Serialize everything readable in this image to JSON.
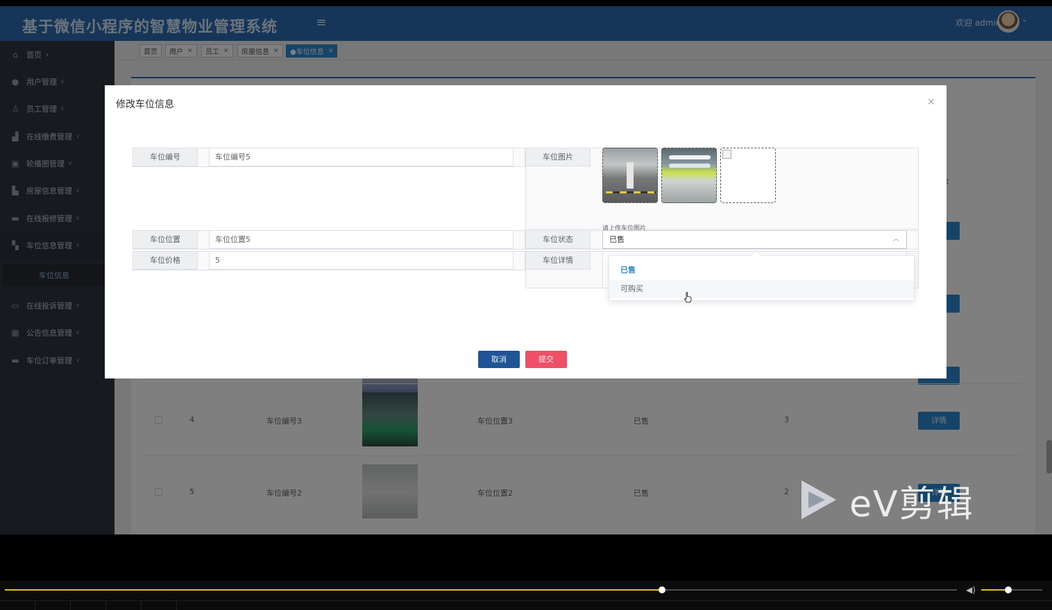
{
  "header": {
    "app_title": "基于微信小程序的智慧物业管理系统",
    "welcome": "欢迎 admin"
  },
  "sidebar": {
    "items": [
      {
        "label": "首页",
        "icon": "home-icon"
      },
      {
        "label": "用户管理",
        "icon": "user-icon"
      },
      {
        "label": "员工管理",
        "icon": "staff-icon"
      },
      {
        "label": "在线缴费管理",
        "icon": "payment-icon"
      },
      {
        "label": "轮播图管理",
        "icon": "carousel-icon"
      },
      {
        "label": "房屋信息管理",
        "icon": "house-icon"
      },
      {
        "label": "在线报修管理",
        "icon": "repair-icon"
      },
      {
        "label": "车位信息管理",
        "icon": "parking-icon"
      },
      {
        "label": "在线投诉管理",
        "icon": "complaint-icon"
      },
      {
        "label": "公告信息管理",
        "icon": "notice-icon"
      },
      {
        "label": "车位订单管理",
        "icon": "order-icon"
      }
    ],
    "sub_item": "车位信息"
  },
  "tabs": [
    {
      "label": "首页",
      "closable": false
    },
    {
      "label": "用户",
      "closable": true
    },
    {
      "label": "员工",
      "closable": true
    },
    {
      "label": "房屋信息",
      "closable": true
    },
    {
      "label": "●车位信息",
      "closable": true
    }
  ],
  "table": {
    "rows": [
      {
        "index": "4",
        "code": "车位编号3",
        "location": "车位位置3",
        "status": "已售",
        "price": "3",
        "action": "详情"
      },
      {
        "index": "5",
        "code": "车位编号2",
        "location": "车位位置2",
        "status": "已售",
        "price": "2",
        "action": "详情"
      }
    ],
    "partial_header": "E",
    "button_label": "详情"
  },
  "dialog": {
    "title": "修改车位信息",
    "close": "×",
    "fields": {
      "code_label": "车位编号",
      "code_value": "车位编号5",
      "image_label": "车位图片",
      "upload_hint": "请上传车位图片",
      "location_label": "车位位置",
      "location_value": "车位位置5",
      "status_label": "车位状态",
      "status_value": "已售",
      "price_label": "车位价格",
      "price_value": "5",
      "detail_label": "车位详情"
    },
    "status_options": [
      "已售",
      "可购买"
    ],
    "cancel_label": "取消",
    "submit_label": "提交"
  },
  "watermark": "eV剪辑",
  "player": {
    "progress": 0.69,
    "volume": 0.44,
    "accent_color": "#e4c01a"
  }
}
